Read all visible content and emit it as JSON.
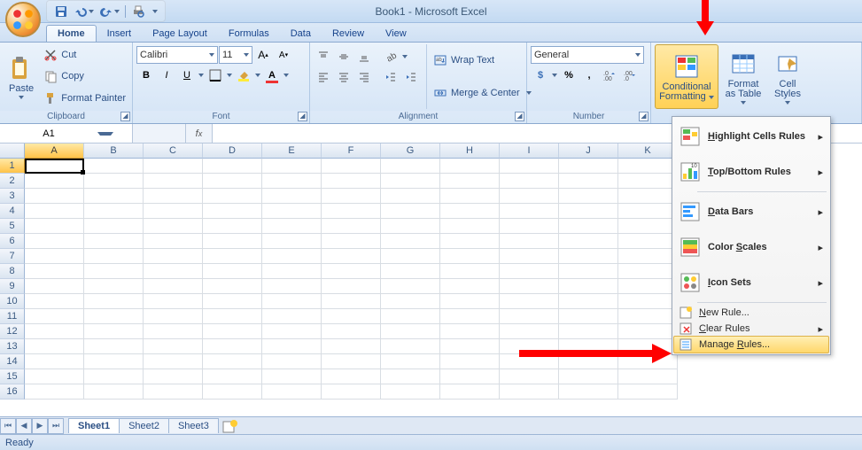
{
  "title": "Book1 - Microsoft Excel",
  "qat": {
    "save": "save-icon",
    "undo": "undo-icon",
    "redo": "redo-icon",
    "print": "print-preview-icon"
  },
  "tabs": [
    "Home",
    "Insert",
    "Page Layout",
    "Formulas",
    "Data",
    "Review",
    "View"
  ],
  "active_tab": "Home",
  "ribbon": {
    "clipboard": {
      "label": "Clipboard",
      "paste": "Paste",
      "cut": "Cut",
      "copy": "Copy",
      "format_painter": "Format Painter"
    },
    "font": {
      "label": "Font",
      "name": "Calibri",
      "size": "11"
    },
    "alignment": {
      "label": "Alignment",
      "wrap": "Wrap Text",
      "merge": "Merge & Center"
    },
    "number": {
      "label": "Number",
      "format": "General"
    },
    "styles": {
      "cond": "Conditional Formatting",
      "table": "Format as Table",
      "cell": "Cell Styles"
    }
  },
  "namebox": "A1",
  "columns": [
    "A",
    "B",
    "C",
    "D",
    "E",
    "F",
    "G",
    "H",
    "I",
    "J",
    "K"
  ],
  "rows": [
    1,
    2,
    3,
    4,
    5,
    6,
    7,
    8,
    9,
    10,
    11,
    12,
    13,
    14,
    15,
    16
  ],
  "sheets": [
    "Sheet1",
    "Sheet2",
    "Sheet3"
  ],
  "status": "Ready",
  "cf_menu": {
    "highlight": "Highlight Cells Rules",
    "topbottom": "Top/Bottom Rules",
    "databars": "Data Bars",
    "colorscales": "Color Scales",
    "iconsets": "Icon Sets",
    "newrule": "New Rule...",
    "clear": "Clear Rules",
    "manage": "Manage Rules..."
  }
}
